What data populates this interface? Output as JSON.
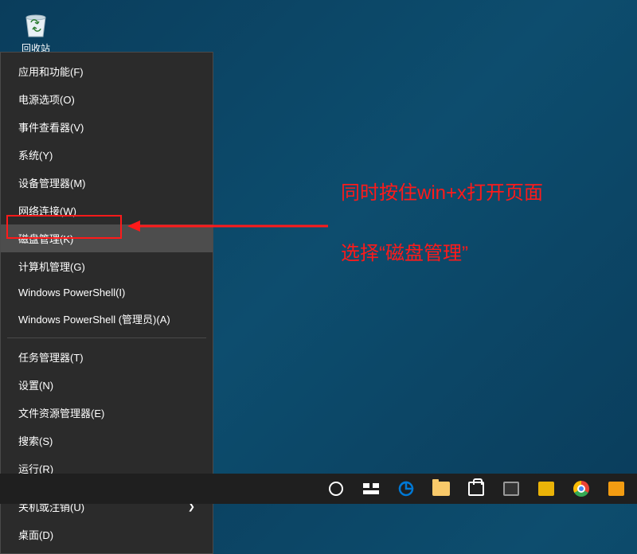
{
  "desktop": {
    "recycle_bin": "回收站"
  },
  "menu": {
    "group1": [
      "应用和功能(F)",
      "电源选项(O)",
      "事件查看器(V)",
      "系统(Y)",
      "设备管理器(M)",
      "网络连接(W)",
      "磁盘管理(K)",
      "计算机管理(G)",
      "Windows PowerShell(I)",
      "Windows PowerShell (管理员)(A)"
    ],
    "group2": [
      "任务管理器(T)",
      "设置(N)",
      "文件资源管理器(E)",
      "搜索(S)",
      "运行(R)"
    ],
    "group3": [
      "关机或注销(U)",
      "桌面(D)"
    ]
  },
  "annotation": {
    "line1": "同时按住win+x打开页面",
    "line2": "选择“磁盘管理”"
  },
  "colors": {
    "accent_red": "#ff1a1a"
  }
}
